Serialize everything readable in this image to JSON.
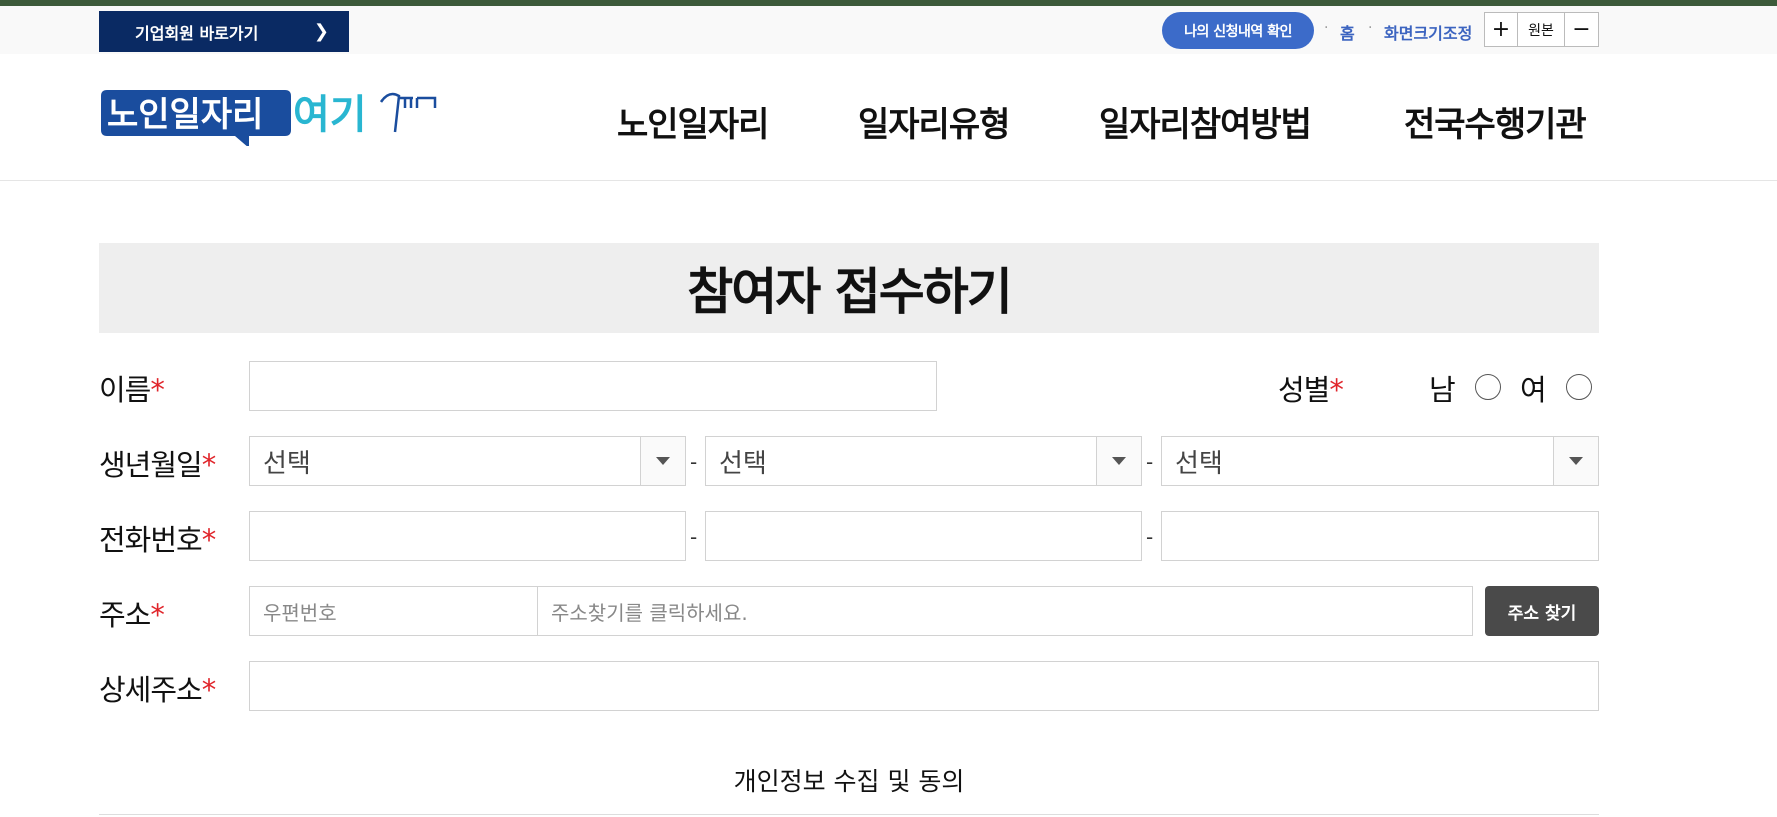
{
  "utility": {
    "corp_link": "기업회원 바로가기",
    "my_applications": "나의 신청내역 확인",
    "home": "홈",
    "screen_size": "화면크기조정",
    "zoom_in": "+",
    "zoom_reset": "원본",
    "zoom_out": "−"
  },
  "header": {
    "logo_text_1": "노인일자리",
    "logo_text_2": "여기",
    "nav": [
      "노인일자리",
      "일자리유형",
      "일자리참여방법",
      "전국수행기관"
    ]
  },
  "form": {
    "title": "참여자 접수하기",
    "required_mark": "*",
    "name_label": "이름",
    "gender_label": "성별",
    "gender_options": [
      "남",
      "여"
    ],
    "birth_label": "생년월일",
    "birth_selects": [
      "선택",
      "선택",
      "선택"
    ],
    "phone_label": "전화번호",
    "address_label": "주소",
    "zipcode_placeholder": "우편번호",
    "address_placeholder": "주소찾기를 클릭하세요.",
    "address_button": "주소 찾기",
    "detail_address_label": "상세주소",
    "dash": "-",
    "consent_title": "개인정보 수집 및 동의"
  },
  "colors": {
    "accent_navy": "#0a2a63",
    "accent_blue": "#3c6bc9",
    "required_red": "#e0252b"
  }
}
